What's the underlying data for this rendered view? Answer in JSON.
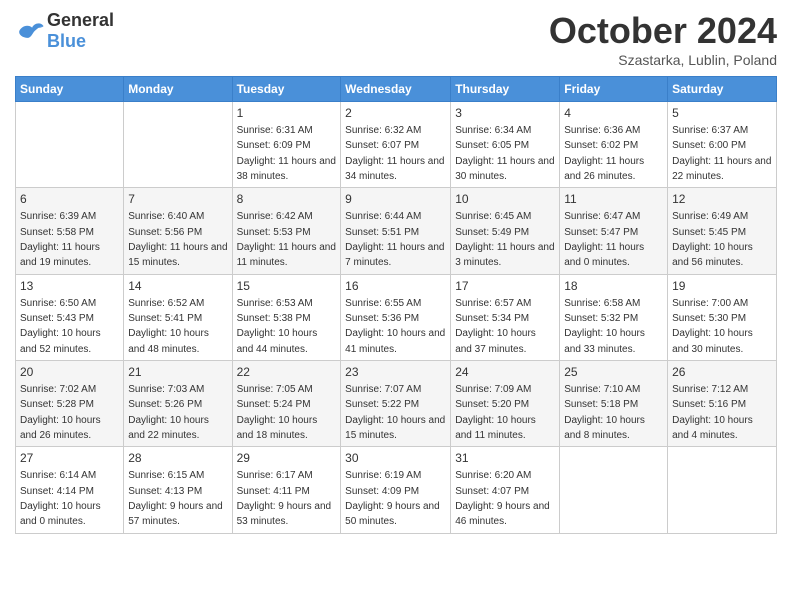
{
  "header": {
    "logo_general": "General",
    "logo_blue": "Blue",
    "month_year": "October 2024",
    "location": "Szastarka, Lublin, Poland"
  },
  "days_of_week": [
    "Sunday",
    "Monday",
    "Tuesday",
    "Wednesday",
    "Thursday",
    "Friday",
    "Saturday"
  ],
  "weeks": [
    [
      {
        "day": "",
        "sunrise": "",
        "sunset": "",
        "daylight": ""
      },
      {
        "day": "",
        "sunrise": "",
        "sunset": "",
        "daylight": ""
      },
      {
        "day": "1",
        "sunrise": "Sunrise: 6:31 AM",
        "sunset": "Sunset: 6:09 PM",
        "daylight": "Daylight: 11 hours and 38 minutes."
      },
      {
        "day": "2",
        "sunrise": "Sunrise: 6:32 AM",
        "sunset": "Sunset: 6:07 PM",
        "daylight": "Daylight: 11 hours and 34 minutes."
      },
      {
        "day": "3",
        "sunrise": "Sunrise: 6:34 AM",
        "sunset": "Sunset: 6:05 PM",
        "daylight": "Daylight: 11 hours and 30 minutes."
      },
      {
        "day": "4",
        "sunrise": "Sunrise: 6:36 AM",
        "sunset": "Sunset: 6:02 PM",
        "daylight": "Daylight: 11 hours and 26 minutes."
      },
      {
        "day": "5",
        "sunrise": "Sunrise: 6:37 AM",
        "sunset": "Sunset: 6:00 PM",
        "daylight": "Daylight: 11 hours and 22 minutes."
      }
    ],
    [
      {
        "day": "6",
        "sunrise": "Sunrise: 6:39 AM",
        "sunset": "Sunset: 5:58 PM",
        "daylight": "Daylight: 11 hours and 19 minutes."
      },
      {
        "day": "7",
        "sunrise": "Sunrise: 6:40 AM",
        "sunset": "Sunset: 5:56 PM",
        "daylight": "Daylight: 11 hours and 15 minutes."
      },
      {
        "day": "8",
        "sunrise": "Sunrise: 6:42 AM",
        "sunset": "Sunset: 5:53 PM",
        "daylight": "Daylight: 11 hours and 11 minutes."
      },
      {
        "day": "9",
        "sunrise": "Sunrise: 6:44 AM",
        "sunset": "Sunset: 5:51 PM",
        "daylight": "Daylight: 11 hours and 7 minutes."
      },
      {
        "day": "10",
        "sunrise": "Sunrise: 6:45 AM",
        "sunset": "Sunset: 5:49 PM",
        "daylight": "Daylight: 11 hours and 3 minutes."
      },
      {
        "day": "11",
        "sunrise": "Sunrise: 6:47 AM",
        "sunset": "Sunset: 5:47 PM",
        "daylight": "Daylight: 11 hours and 0 minutes."
      },
      {
        "day": "12",
        "sunrise": "Sunrise: 6:49 AM",
        "sunset": "Sunset: 5:45 PM",
        "daylight": "Daylight: 10 hours and 56 minutes."
      }
    ],
    [
      {
        "day": "13",
        "sunrise": "Sunrise: 6:50 AM",
        "sunset": "Sunset: 5:43 PM",
        "daylight": "Daylight: 10 hours and 52 minutes."
      },
      {
        "day": "14",
        "sunrise": "Sunrise: 6:52 AM",
        "sunset": "Sunset: 5:41 PM",
        "daylight": "Daylight: 10 hours and 48 minutes."
      },
      {
        "day": "15",
        "sunrise": "Sunrise: 6:53 AM",
        "sunset": "Sunset: 5:38 PM",
        "daylight": "Daylight: 10 hours and 44 minutes."
      },
      {
        "day": "16",
        "sunrise": "Sunrise: 6:55 AM",
        "sunset": "Sunset: 5:36 PM",
        "daylight": "Daylight: 10 hours and 41 minutes."
      },
      {
        "day": "17",
        "sunrise": "Sunrise: 6:57 AM",
        "sunset": "Sunset: 5:34 PM",
        "daylight": "Daylight: 10 hours and 37 minutes."
      },
      {
        "day": "18",
        "sunrise": "Sunrise: 6:58 AM",
        "sunset": "Sunset: 5:32 PM",
        "daylight": "Daylight: 10 hours and 33 minutes."
      },
      {
        "day": "19",
        "sunrise": "Sunrise: 7:00 AM",
        "sunset": "Sunset: 5:30 PM",
        "daylight": "Daylight: 10 hours and 30 minutes."
      }
    ],
    [
      {
        "day": "20",
        "sunrise": "Sunrise: 7:02 AM",
        "sunset": "Sunset: 5:28 PM",
        "daylight": "Daylight: 10 hours and 26 minutes."
      },
      {
        "day": "21",
        "sunrise": "Sunrise: 7:03 AM",
        "sunset": "Sunset: 5:26 PM",
        "daylight": "Daylight: 10 hours and 22 minutes."
      },
      {
        "day": "22",
        "sunrise": "Sunrise: 7:05 AM",
        "sunset": "Sunset: 5:24 PM",
        "daylight": "Daylight: 10 hours and 18 minutes."
      },
      {
        "day": "23",
        "sunrise": "Sunrise: 7:07 AM",
        "sunset": "Sunset: 5:22 PM",
        "daylight": "Daylight: 10 hours and 15 minutes."
      },
      {
        "day": "24",
        "sunrise": "Sunrise: 7:09 AM",
        "sunset": "Sunset: 5:20 PM",
        "daylight": "Daylight: 10 hours and 11 minutes."
      },
      {
        "day": "25",
        "sunrise": "Sunrise: 7:10 AM",
        "sunset": "Sunset: 5:18 PM",
        "daylight": "Daylight: 10 hours and 8 minutes."
      },
      {
        "day": "26",
        "sunrise": "Sunrise: 7:12 AM",
        "sunset": "Sunset: 5:16 PM",
        "daylight": "Daylight: 10 hours and 4 minutes."
      }
    ],
    [
      {
        "day": "27",
        "sunrise": "Sunrise: 6:14 AM",
        "sunset": "Sunset: 4:14 PM",
        "daylight": "Daylight: 10 hours and 0 minutes."
      },
      {
        "day": "28",
        "sunrise": "Sunrise: 6:15 AM",
        "sunset": "Sunset: 4:13 PM",
        "daylight": "Daylight: 9 hours and 57 minutes."
      },
      {
        "day": "29",
        "sunrise": "Sunrise: 6:17 AM",
        "sunset": "Sunset: 4:11 PM",
        "daylight": "Daylight: 9 hours and 53 minutes."
      },
      {
        "day": "30",
        "sunrise": "Sunrise: 6:19 AM",
        "sunset": "Sunset: 4:09 PM",
        "daylight": "Daylight: 9 hours and 50 minutes."
      },
      {
        "day": "31",
        "sunrise": "Sunrise: 6:20 AM",
        "sunset": "Sunset: 4:07 PM",
        "daylight": "Daylight: 9 hours and 46 minutes."
      },
      {
        "day": "",
        "sunrise": "",
        "sunset": "",
        "daylight": ""
      },
      {
        "day": "",
        "sunrise": "",
        "sunset": "",
        "daylight": ""
      }
    ]
  ]
}
